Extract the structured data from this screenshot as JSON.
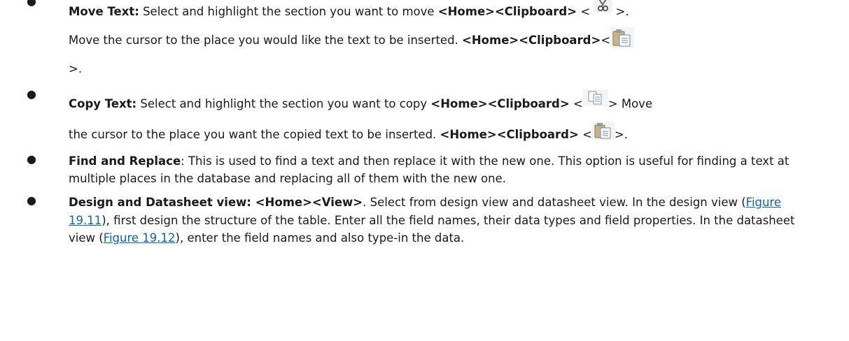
{
  "items": [
    {
      "label": "Move Text:",
      "line1_text": " Select and highlight the section you want to move ",
      "line1_path": "<Home><Clipboard>",
      "line1_open": " < ",
      "line1_close": " >.",
      "line2_text": "Move the cursor to the place you would like the text to be inserted. ",
      "line2_path": "<Home><Clipboard>",
      "line2_open": "<",
      "line3_close": ">."
    },
    {
      "label": "Copy Text:",
      "line1_text": " Select and highlight the section you want to copy ",
      "line1_path": "<Home><Clipboard>",
      "line1_open": " <",
      "line1_close": "> Move",
      "line2_text": "the cursor to the place you want the copied text to be inserted. ",
      "line2_path": "<Home><Clipboard>",
      "line2_open": " <",
      "line2_close": ">."
    },
    {
      "label": "Find and Replace",
      "text": ": This is used to find a text and then replace it with the new one. This option is useful for finding a text at multiple places in the database and replacing all of them with the new one."
    },
    {
      "label": "Design and Datasheet view: <Home><View>",
      "text1": ". Select from design view and datasheet view. In the design view (",
      "link1": "Figure 19.11",
      "text2": "), first design the structure of the table. Enter all the field names, their data types and field properties. In the datasheet view (",
      "link2": "Figure 19.12",
      "text3": "), enter the field names and also type-in the data."
    }
  ],
  "icons": {
    "cut": "scissors-icon",
    "paste": "clipboard-paste-icon",
    "copy": "copy-icon"
  },
  "colors": {
    "text": "#1a1a1a",
    "link": "#0b62c4"
  }
}
